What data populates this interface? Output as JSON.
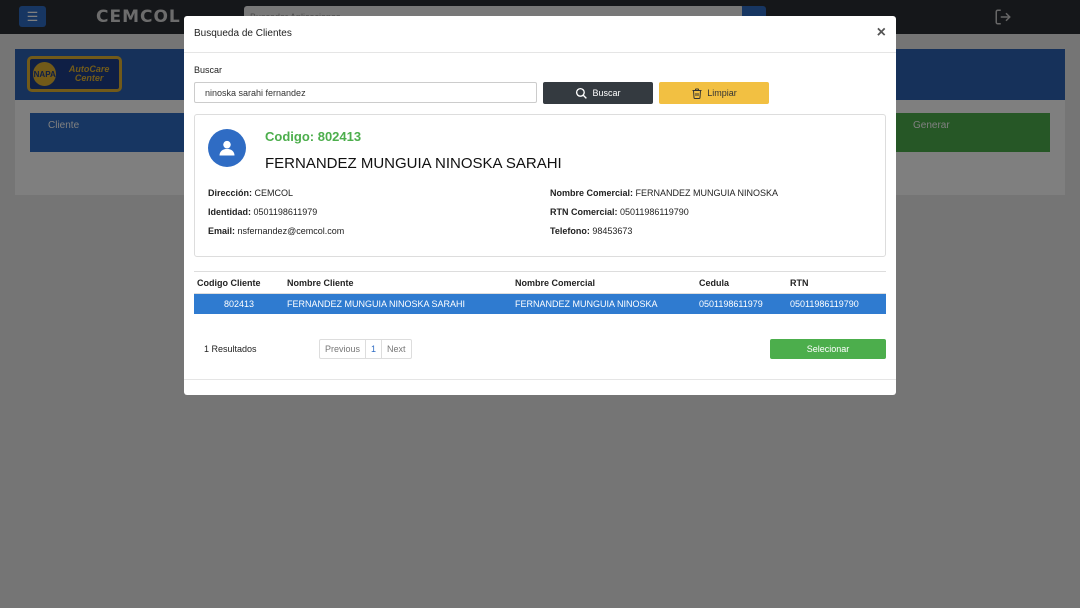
{
  "app": {
    "brand": "CEMCOL",
    "search_placeholder": "Buscador Aplicaciones",
    "logo_text": "AutoCare Center",
    "steps": {
      "cliente": "Cliente",
      "generar": "Generar"
    }
  },
  "modal": {
    "title": "Busqueda de Clientes",
    "search_label": "Buscar",
    "search_value": "ninoska sarahi fernandez",
    "buscar_label": "Buscar",
    "limpiar_label": "Limpiar"
  },
  "client": {
    "codigo_label": "Codigo:",
    "codigo": "802413",
    "name": "FERNANDEZ MUNGUIA NINOSKA SARAHI",
    "direccion_label": "Dirección:",
    "direccion": "CEMCOL",
    "identidad_label": "Identidad:",
    "identidad": "0501198611979",
    "email_label": "Email:",
    "email": "nsfernandez@cemcol.com",
    "nombre_comercial_label": "Nombre Comercial:",
    "nombre_comercial": "FERNANDEZ MUNGUIA NINOSKA",
    "rtn_label": "RTN Comercial:",
    "rtn": "05011986119790",
    "telefono_label": "Telefono:",
    "telefono": "98453673"
  },
  "table": {
    "headers": [
      "Codigo Cliente",
      "Nombre Cliente",
      "Nombre Comercial",
      "Cedula",
      "RTN"
    ],
    "rows": [
      [
        "802413",
        "FERNANDEZ MUNGUIA NINOSKA SARAHI",
        "FERNANDEZ MUNGUIA NINOSKA",
        "0501198611979",
        "05011986119790"
      ]
    ]
  },
  "footer": {
    "results": "1 Resultados",
    "previous": "Previous",
    "page": "1",
    "next": "Next",
    "select_label": "Selecionar"
  }
}
